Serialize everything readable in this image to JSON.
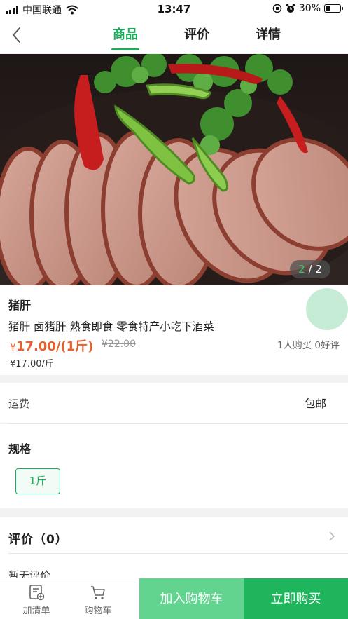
{
  "status_bar": {
    "carrier": "中国联通",
    "time": "13:47",
    "battery": "30%",
    "battery_level": 0.3
  },
  "nav": {
    "tabs": [
      {
        "label": "商品",
        "active": true
      },
      {
        "label": "评价",
        "active": false
      },
      {
        "label": "详情",
        "active": false
      }
    ]
  },
  "gallery": {
    "current": "2",
    "separator": "/",
    "total": "2"
  },
  "product": {
    "name": "猪肝",
    "description": "猪肝 卤猪肝 熟食即食 零食特产小吃下酒菜",
    "currency": "¥",
    "price": "17.00/(1斤)",
    "original_price": "¥22.00",
    "unit_price": "¥17.00/斤",
    "stats": "1人购买 0好评"
  },
  "shipping": {
    "label": "运费",
    "value": "包邮"
  },
  "spec": {
    "title": "规格",
    "options": [
      "1斤"
    ]
  },
  "reviews": {
    "title": "评价（0）",
    "empty_text": "暂无评价"
  },
  "bottom_bar": {
    "list_label": "加清单",
    "cart_label": "购物车",
    "add_to_cart": "加入购物车",
    "buy_now": "立即购买"
  },
  "colors": {
    "accent": "#1aad5b",
    "price": "#e8602c",
    "add_to_cart_bg": "#62d48f",
    "buy_now_bg": "#1fb55c"
  }
}
